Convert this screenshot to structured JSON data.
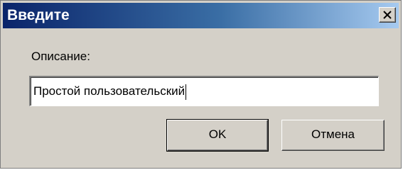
{
  "window": {
    "title": "Введите",
    "close_icon": "close-icon"
  },
  "form": {
    "label": "Описание:",
    "input_value": "Простой пользовательский"
  },
  "buttons": {
    "ok_label": "OK",
    "cancel_label": "Отмена"
  }
}
